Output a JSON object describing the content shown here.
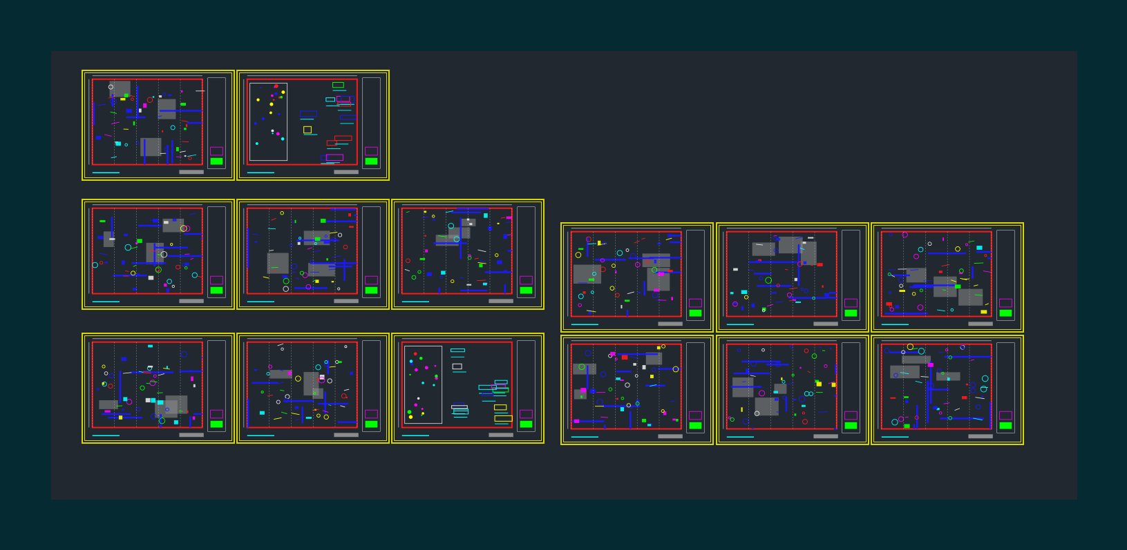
{
  "colors": {
    "background": "#062a31",
    "modelspace": "#212830",
    "frame": "#d8d800",
    "lineRed": "#ff1a1a",
    "lineBlue": "#1a1aff",
    "lineYellow": "#ffff00",
    "lineGreen": "#00ff00",
    "lineCyan": "#00ffff",
    "lineMagenta": "#ff00ff",
    "lineWhite": "#e6e6e6",
    "fillGrey": "#8c8c8c"
  },
  "sheets": [
    {
      "id": "A1",
      "kind": "plan"
    },
    {
      "id": "A2",
      "kind": "details"
    },
    {
      "id": "B1",
      "kind": "plan"
    },
    {
      "id": "B2",
      "kind": "plan"
    },
    {
      "id": "B3",
      "kind": "plan"
    },
    {
      "id": "C1",
      "kind": "plan"
    },
    {
      "id": "C2",
      "kind": "plan"
    },
    {
      "id": "C3",
      "kind": "details"
    },
    {
      "id": "D1",
      "kind": "plan"
    },
    {
      "id": "D2",
      "kind": "plan"
    },
    {
      "id": "D3",
      "kind": "plan"
    },
    {
      "id": "E1",
      "kind": "plan"
    },
    {
      "id": "E2",
      "kind": "plan"
    },
    {
      "id": "E3",
      "kind": "plan"
    }
  ]
}
